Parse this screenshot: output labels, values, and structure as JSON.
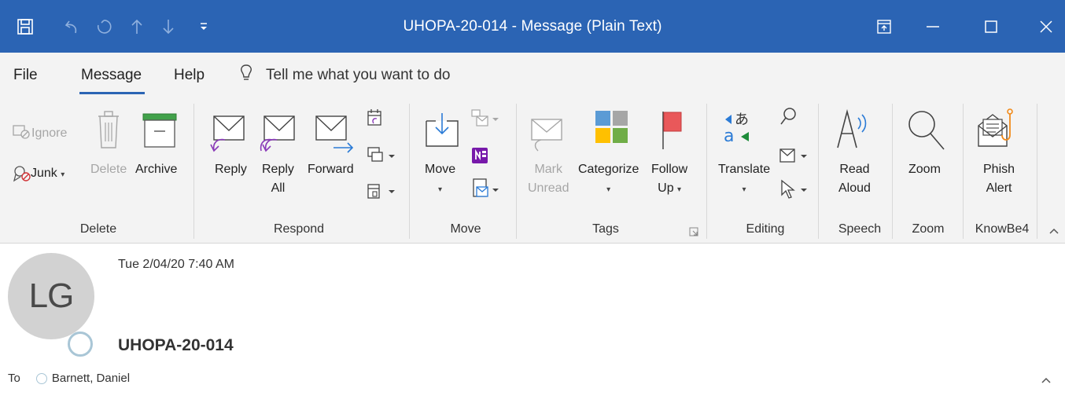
{
  "window": {
    "title": "UHOPA-20-014  -  Message (Plain Text)",
    "accent_color": "#2b64b4"
  },
  "quick_access": [
    "save-icon",
    "undo-icon",
    "redo-icon",
    "up-arrow-icon",
    "down-arrow-icon",
    "customize-dropdown-icon"
  ],
  "tabs": {
    "file": "File",
    "message": "Message",
    "help": "Help",
    "tell_me": "Tell me what you want to do"
  },
  "ribbon": {
    "delete_group": {
      "label": "Delete",
      "ignore": "Ignore",
      "junk": "Junk",
      "delete": "Delete",
      "archive": "Archive"
    },
    "respond_group": {
      "label": "Respond",
      "reply": "Reply",
      "reply_all_1": "Reply",
      "reply_all_2": "All",
      "forward": "Forward"
    },
    "move_group": {
      "label": "Move",
      "move": "Move"
    },
    "tags_group": {
      "label": "Tags",
      "mark_unread_1": "Mark",
      "mark_unread_2": "Unread",
      "categorize": "Categorize",
      "follow_up_1": "Follow",
      "follow_up_2": "Up"
    },
    "editing_group": {
      "label": "Editing",
      "translate": "Translate"
    },
    "speech_group": {
      "label": "Speech",
      "read_aloud_1": "Read",
      "read_aloud_2": "Aloud"
    },
    "zoom_group": {
      "label": "Zoom",
      "zoom": "Zoom"
    },
    "knowbe4_group": {
      "label": "KnowBe4",
      "phish_alert_1": "Phish",
      "phish_alert_2": "Alert"
    }
  },
  "message": {
    "avatar_initials": "LG",
    "date": "Tue 2/04/20 7:40 AM",
    "subject": "UHOPA-20-014",
    "to_label": "To",
    "to_recipient": "Barnett, Daniel"
  }
}
